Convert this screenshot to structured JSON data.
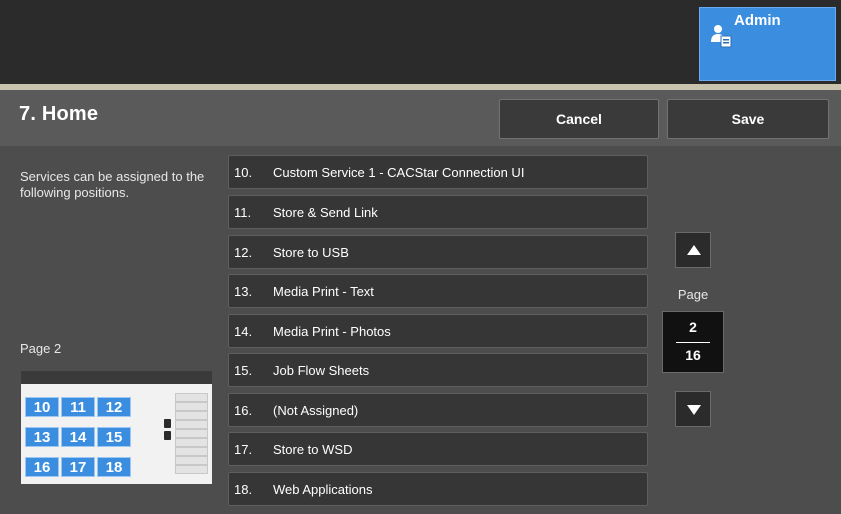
{
  "header": {
    "admin_label": "Admin",
    "admin_icon": "admin-user-icon",
    "accent_color": "#3b8de0"
  },
  "title": "7. Home",
  "buttons": {
    "cancel": "Cancel",
    "save": "Save"
  },
  "description": "Services can be assigned to the following positions.",
  "page_label_left": "Page 2",
  "position_map": {
    "rows": [
      [
        "10",
        "11",
        "12"
      ],
      [
        "13",
        "14",
        "15"
      ],
      [
        "16",
        "17",
        "18"
      ]
    ]
  },
  "services": [
    {
      "num": "10.",
      "label": "Custom Service 1 - CACStar Connection UI"
    },
    {
      "num": "11.",
      "label": "Store & Send Link"
    },
    {
      "num": "12.",
      "label": "Store to USB"
    },
    {
      "num": "13.",
      "label": "Media Print - Text"
    },
    {
      "num": "14.",
      "label": "Media Print - Photos"
    },
    {
      "num": "15.",
      "label": "Job Flow Sheets"
    },
    {
      "num": "16.",
      "label": "(Not Assigned)"
    },
    {
      "num": "17.",
      "label": "Store to WSD"
    },
    {
      "num": "18.",
      "label": "Web Applications"
    }
  ],
  "pager": {
    "label": "Page",
    "current": "2",
    "total": "16",
    "up_icon": "arrow-up-icon",
    "down_icon": "arrow-down-icon"
  }
}
